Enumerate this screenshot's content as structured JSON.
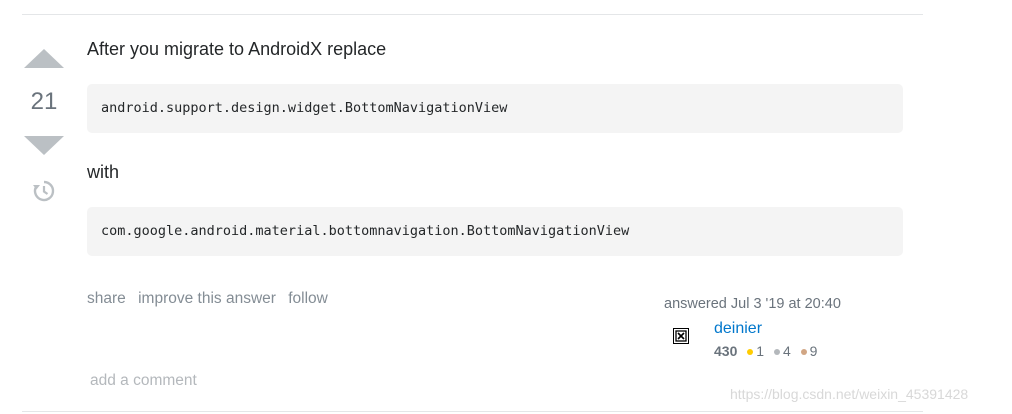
{
  "votes": {
    "count": "21"
  },
  "post": {
    "paragraph1": "After you migrate to AndroidX replace",
    "code1": "android.support.design.widget.BottomNavigationView",
    "paragraph2": "with",
    "code2": "com.google.android.material.bottomnavigation.BottomNavigationView"
  },
  "menu": {
    "share": "share",
    "improve": "improve this answer",
    "follow": "follow"
  },
  "signature": {
    "answered": "answered Jul 3 '19 at 20:40",
    "username": "deinier",
    "reputation": "430",
    "badges": {
      "gold": "1",
      "silver": "4",
      "bronze": "9"
    }
  },
  "comments": {
    "add_label": "add a comment"
  },
  "watermark": "https://blog.csdn.net/weixin_45391428",
  "colors": {
    "link": "#0077cc",
    "vote_arrow": "#bbc0c4",
    "code_bg": "#f4f4f4"
  },
  "icons": {
    "history": "history-icon",
    "avatar": "broken-image-icon"
  }
}
